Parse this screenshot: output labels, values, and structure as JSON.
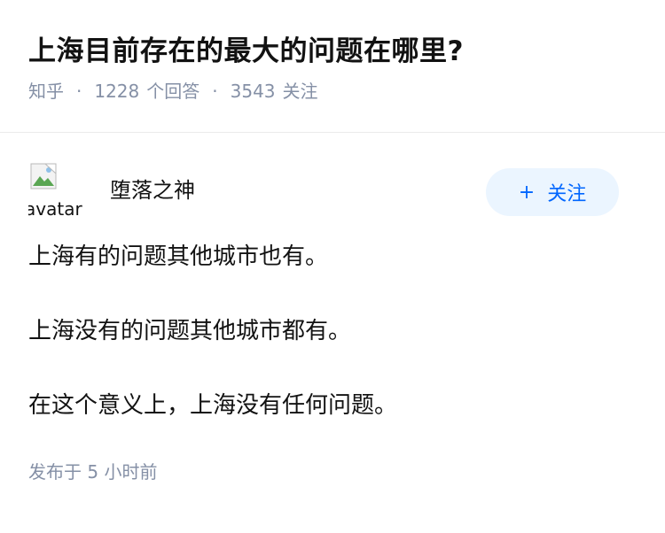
{
  "question": {
    "title": "上海目前存在的最大的问题在哪里?",
    "source": "知乎",
    "separator": "·",
    "answer_count": "1228",
    "answer_label": "个回答",
    "follower_count": "3543",
    "follower_label": "关注"
  },
  "answer": {
    "author": {
      "avatar_alt": "avatar",
      "name": "堕落之神"
    },
    "follow_button": {
      "icon": "+",
      "label": "关注"
    },
    "paragraphs": [
      "上海有的问题其他城市也有。",
      "上海没有的问题其他城市都有。",
      "在这个意义上，上海没有任何问题。"
    ],
    "publish_time": "发布于 5 小时前"
  },
  "colors": {
    "text": "#121212",
    "meta": "#8590a6",
    "accent": "#0066ff",
    "button_bg": "#ebf5ff"
  }
}
